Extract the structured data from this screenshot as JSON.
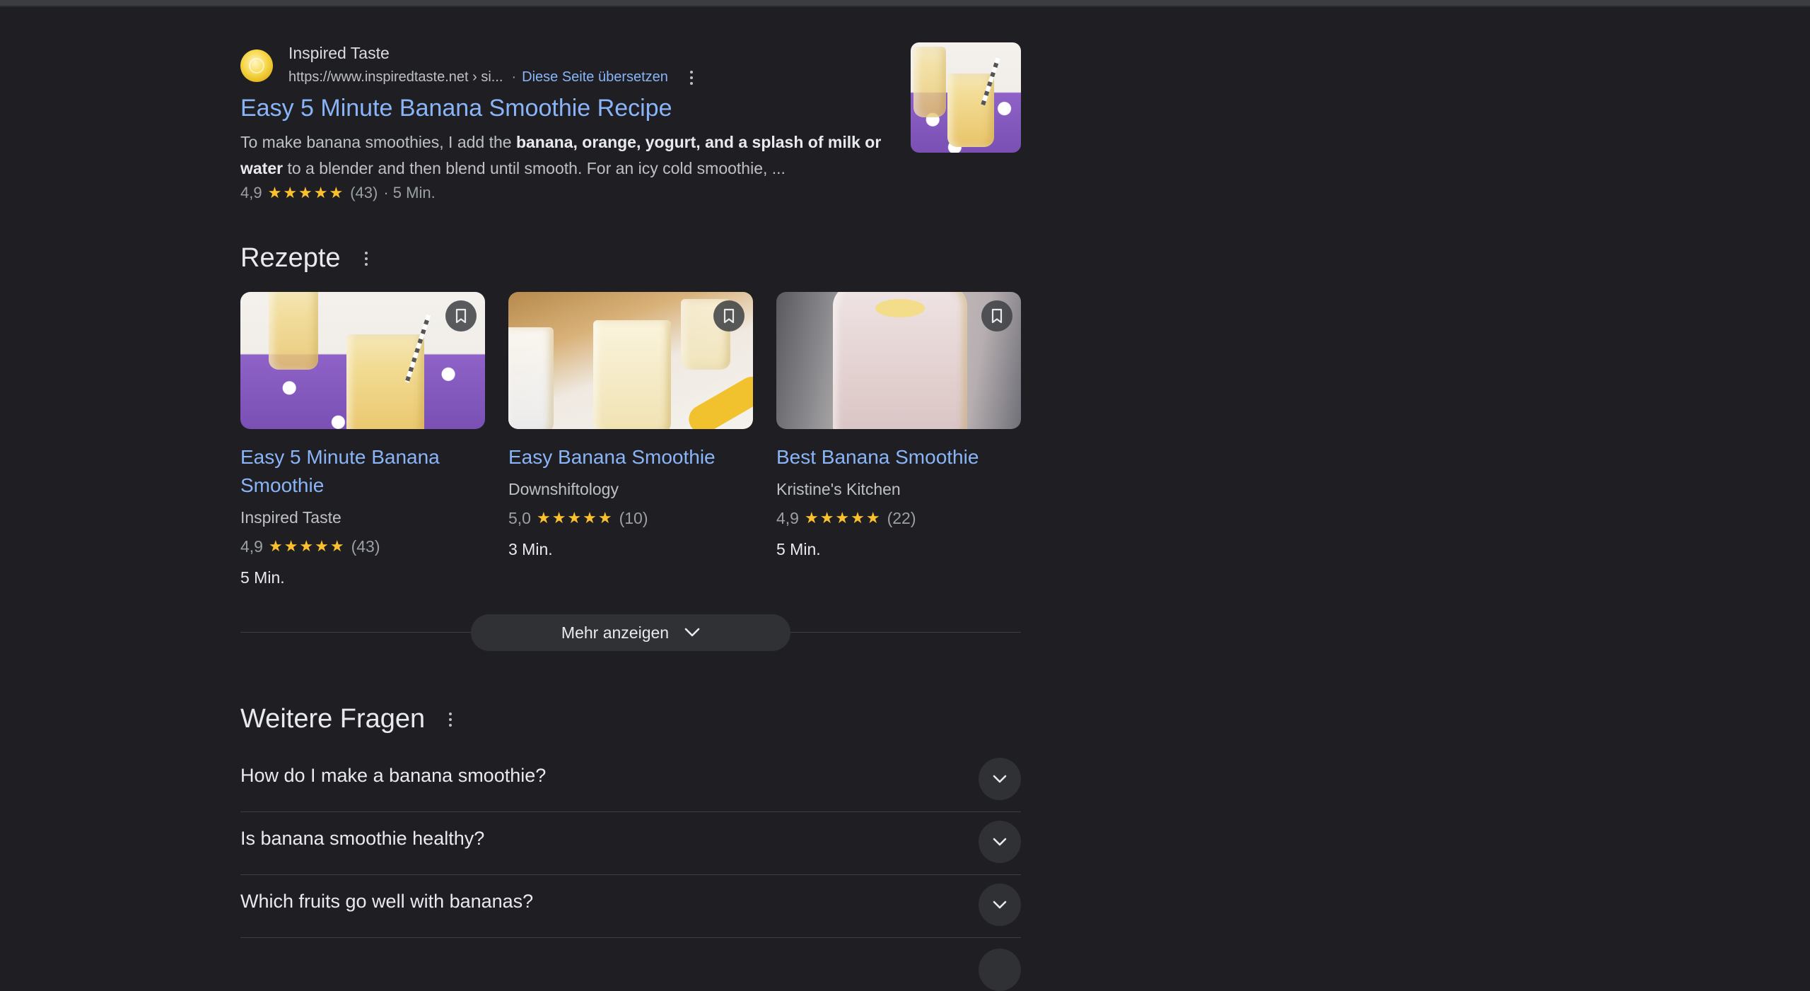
{
  "result": {
    "site_name": "Inspired Taste",
    "url": "https://www.inspiredtaste.net › si...",
    "separator": "·",
    "translate_link": "Diese Seite übersetzen",
    "title": "Easy 5 Minute Banana Smoothie Recipe",
    "snippet_part1": "To make banana smoothies, I add the ",
    "snippet_bold1": "banana, orange, yogurt, and a splash of milk or water",
    "snippet_part2": " to a blender and then blend until smooth. For an icy cold smoothie, ...",
    "rating": "4,9",
    "stars": "★★★★★",
    "rating_count": "(43)",
    "time": "· 5 Min."
  },
  "recipes": {
    "heading": "Rezepte",
    "cards": [
      {
        "title": "Easy 5 Minute Banana Smoothie",
        "source": "Inspired Taste",
        "rating": "4,9",
        "stars": "★★★★★",
        "count": "(43)",
        "time": "5 Min."
      },
      {
        "title": "Easy Banana Smoothie",
        "source": "Downshiftology",
        "rating": "5,0",
        "stars": "★★★★★",
        "count": "(10)",
        "time": "3 Min."
      },
      {
        "title": "Best Banana Smoothie",
        "source": "Kristine's Kitchen",
        "rating": "4,9",
        "stars": "★★★★★",
        "count": "(22)",
        "time": "5 Min."
      }
    ],
    "more_label": "Mehr anzeigen"
  },
  "questions": {
    "heading": "Weitere Fragen",
    "items": [
      "How do I make a banana smoothie?",
      "Is banana smoothie healthy?",
      "Which fruits go well with bananas?"
    ]
  },
  "colors": {
    "background": "#1f1f23",
    "link": "#8ab4f8",
    "star": "#fbc02d"
  }
}
